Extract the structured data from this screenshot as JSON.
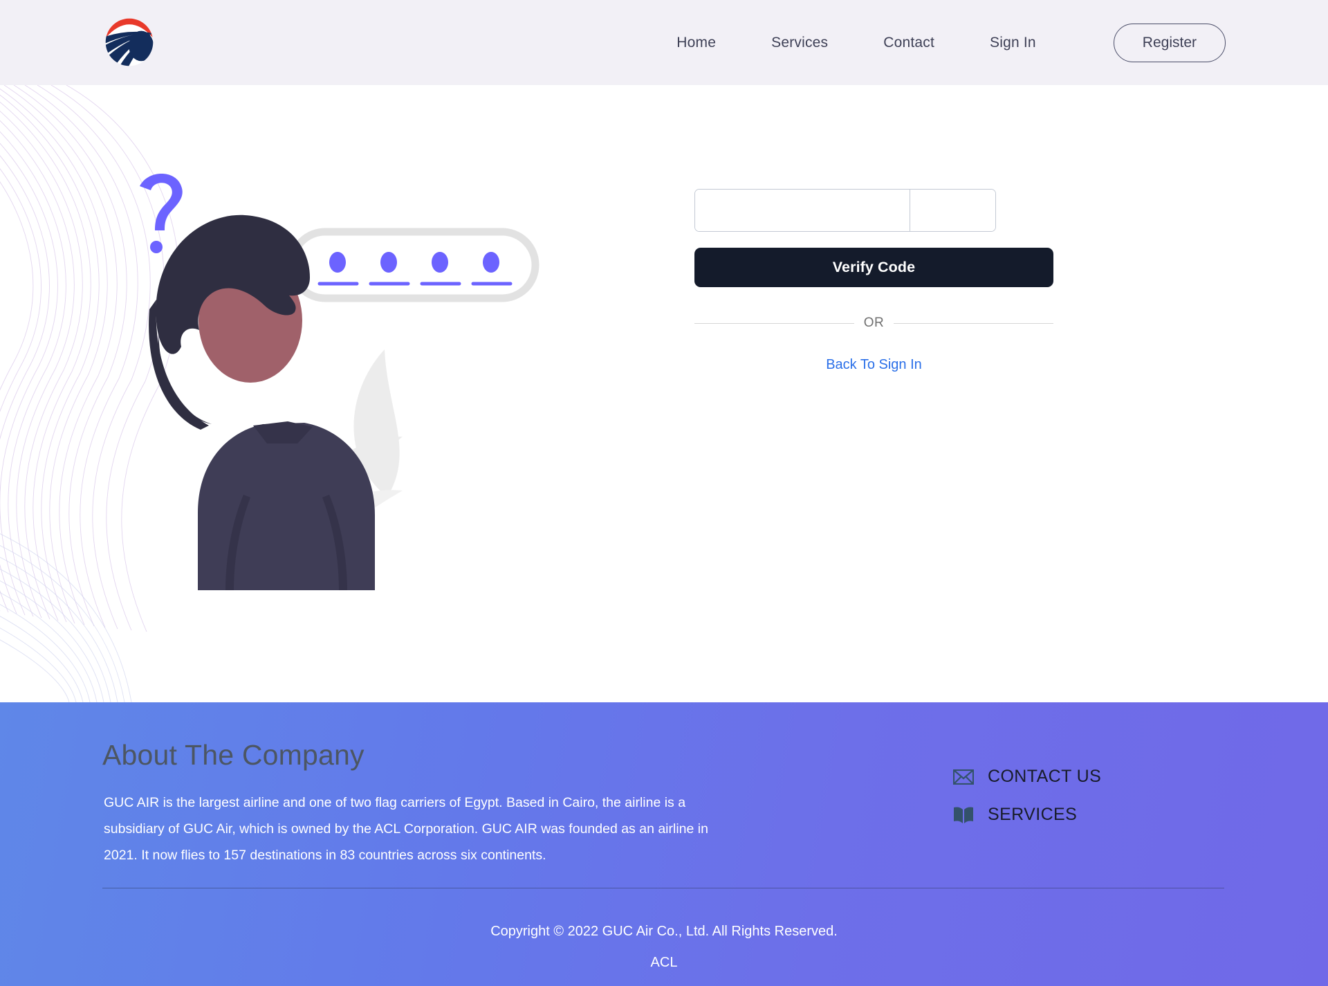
{
  "brand": {
    "logo_icon": "guc-air-logo-icon",
    "logo_colors": {
      "red": "#e8392a",
      "navy": "#132d5c"
    }
  },
  "header": {
    "background": "#f2f0f6",
    "nav_items": [
      {
        "label": "Home",
        "name": "nav-link-home"
      },
      {
        "label": "Services",
        "name": "nav-link-services"
      },
      {
        "label": "Contact",
        "name": "nav-link-contact"
      },
      {
        "label": "Sign In",
        "name": "nav-link-sign-in"
      }
    ],
    "register_label": "Register"
  },
  "illustration": {
    "name": "forgot-password-illustration",
    "question_mark_icon": "question-mark-icon",
    "dots_count": 4,
    "accent": "#6c63ff",
    "hair_color": "#2f2e41",
    "skin_color": "#a0616a",
    "jacket_color": "#3f3d56",
    "leaf_color": "#e6e6e6"
  },
  "form": {
    "code_length": 6,
    "code_values": [
      "",
      "",
      "",
      "",
      "",
      ""
    ],
    "code_placeholder": "",
    "verify_label": "Verify Code",
    "verify_bg": "#141b2b",
    "or_label": "OR",
    "back_link_label": "Back To Sign In",
    "link_color": "#2a6fe8"
  },
  "footer": {
    "gradient_from": "#5f87e8",
    "gradient_to": "#7069e8",
    "about_title": "About The Company",
    "about_body": "GUC AIR is the largest airline and one of two flag carriers of Egypt. Based in Cairo, the airline is a subsidiary of GUC Air, which is owned by the ACL Corporation. GUC AIR was founded as an airline in 2021. It now flies to 157 destinations in 83 countries across six continents.",
    "links": [
      {
        "label": "CONTACT US",
        "icon": "envelope-icon",
        "name": "footer-link-contact-us"
      },
      {
        "label": "SERVICES",
        "icon": "open-book-icon",
        "name": "footer-link-services"
      }
    ],
    "copyright_line1": "Copyright © 2022 GUC Air Co., Ltd. All Rights Reserved.",
    "copyright_line2": "ACL"
  }
}
